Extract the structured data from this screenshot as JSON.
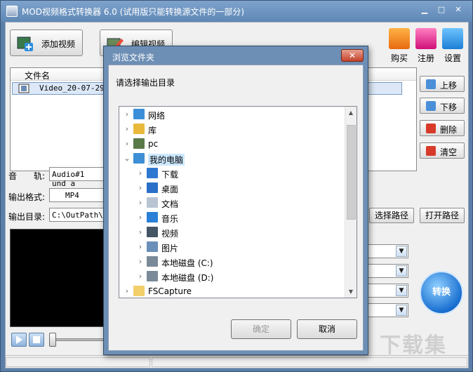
{
  "window": {
    "title": "MOD视频格式转换器 6.0 (试用版只能转换源文件的一部分)"
  },
  "toolbar": {
    "add_video": "添加视频",
    "edit_video": "编辑视频",
    "buy": "购买",
    "register": "注册",
    "settings": "设置"
  },
  "filelist": {
    "header": "文件名",
    "rows": [
      "Video_20-07-29_1"
    ]
  },
  "side_buttons": {
    "up": "上移",
    "down": "下移",
    "delete": "删除",
    "clear": "清空"
  },
  "audio": {
    "label": "音　　轨:",
    "value": "Audio#1 und a"
  },
  "format": {
    "label": "输出格式:",
    "value": "MP4"
  },
  "output_dir": {
    "label": "输出目录:",
    "value": "C:\\OutPath\\",
    "choose": "选择路径",
    "open": "打开路径"
  },
  "convert": {
    "label": "转换"
  },
  "dialog": {
    "title": "浏览文件夹",
    "close": "✕",
    "prompt": "请选择输出目录",
    "tree": [
      {
        "label": "网络",
        "icon": "network-icon",
        "color": "#3b8fd9"
      },
      {
        "label": "库",
        "icon": "library-icon",
        "color": "#e8b93a"
      },
      {
        "label": "pc",
        "icon": "user-icon",
        "color": "#5a7a4a"
      },
      {
        "label": "我的电脑",
        "icon": "computer-icon",
        "color": "#3d8fd6"
      },
      {
        "label": "下载",
        "icon": "download-icon",
        "color": "#2f78d0"
      },
      {
        "label": "桌面",
        "icon": "desktop-icon",
        "color": "#2a6fc8"
      },
      {
        "label": "文档",
        "icon": "document-icon",
        "color": "#b8c4d2"
      },
      {
        "label": "音乐",
        "icon": "music-icon",
        "color": "#2b7fd6"
      },
      {
        "label": "视频",
        "icon": "video-icon",
        "color": "#445566"
      },
      {
        "label": "图片",
        "icon": "picture-icon",
        "color": "#6a8fb8"
      },
      {
        "label": "本地磁盘 (C:)",
        "icon": "disk-c-icon",
        "color": "#7a8a99"
      },
      {
        "label": "本地磁盘 (D:)",
        "icon": "disk-d-icon",
        "color": "#7a8a99"
      },
      {
        "label": "FSCapture",
        "icon": "folder-icon",
        "color": "#f2cf6b"
      }
    ],
    "ok": "确定",
    "cancel": "取消"
  },
  "watermark": "下载集"
}
